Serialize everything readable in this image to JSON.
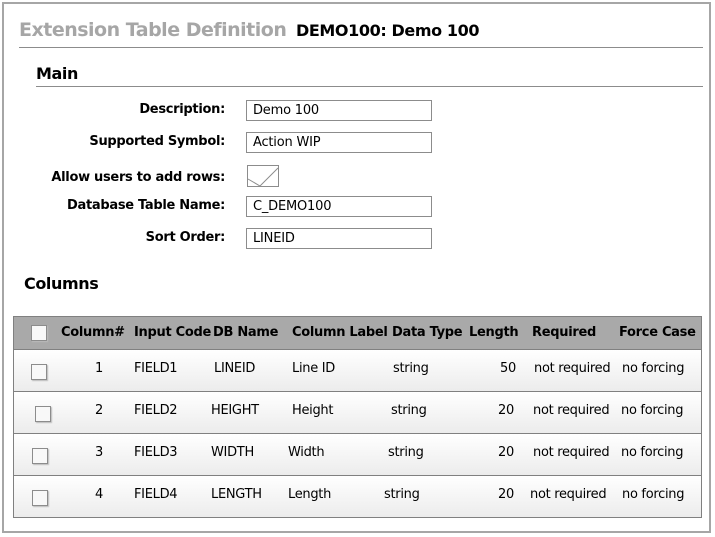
{
  "header": {
    "title": "Extension Table Definition",
    "record": "DEMO100: Demo 100"
  },
  "main": {
    "section_title": "Main",
    "fields": {
      "description": {
        "label": "Description:",
        "value": "Demo 100"
      },
      "supported_symbol": {
        "label": "Supported Symbol:",
        "value": "Action WIP"
      },
      "allow_add_rows": {
        "label": "Allow users to add rows:",
        "checked": false
      },
      "db_table_name": {
        "label": "Database Table Name:",
        "value": "C_DEMO100"
      },
      "sort_order": {
        "label": "Sort Order:",
        "value": "LINEID"
      }
    }
  },
  "columns": {
    "section_title": "Columns",
    "headers": [
      "Column#",
      "Input Code",
      "DB Name",
      "Column Label",
      "Data Type",
      "Length",
      "Required",
      "Force Case"
    ],
    "rows": [
      {
        "num": "1",
        "input_code": "FIELD1",
        "db_name": "LINEID",
        "label": "Line ID",
        "data_type": "string",
        "length": "50",
        "required": "not required",
        "force_case": "no forcing"
      },
      {
        "num": "2",
        "input_code": "FIELD2",
        "db_name": "HEIGHT",
        "label": "Height",
        "data_type": "string",
        "length": "20",
        "required": "not required",
        "force_case": "no forcing"
      },
      {
        "num": "3",
        "input_code": "FIELD3",
        "db_name": "WIDTH",
        "label": "Width",
        "data_type": "string",
        "length": "20",
        "required": "not required",
        "force_case": "no forcing"
      },
      {
        "num": "4",
        "input_code": "FIELD4",
        "db_name": "LENGTH",
        "label": "Length",
        "data_type": "string",
        "length": "20",
        "required": "not required",
        "force_case": "no forcing"
      }
    ]
  }
}
